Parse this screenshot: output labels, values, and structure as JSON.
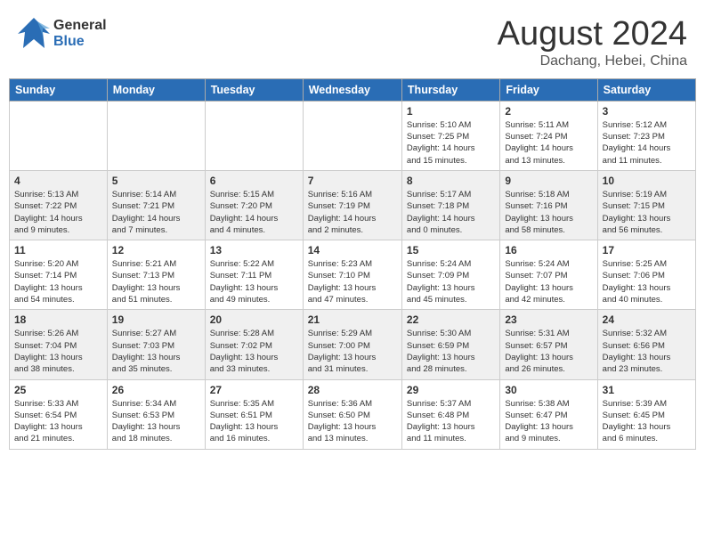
{
  "header": {
    "logo_general": "General",
    "logo_blue": "Blue",
    "month": "August 2024",
    "location": "Dachang, Hebei, China"
  },
  "weekdays": [
    "Sunday",
    "Monday",
    "Tuesday",
    "Wednesday",
    "Thursday",
    "Friday",
    "Saturday"
  ],
  "weeks": [
    [
      {
        "day": "",
        "info": ""
      },
      {
        "day": "",
        "info": ""
      },
      {
        "day": "",
        "info": ""
      },
      {
        "day": "",
        "info": ""
      },
      {
        "day": "1",
        "info": "Sunrise: 5:10 AM\nSunset: 7:25 PM\nDaylight: 14 hours\nand 15 minutes."
      },
      {
        "day": "2",
        "info": "Sunrise: 5:11 AM\nSunset: 7:24 PM\nDaylight: 14 hours\nand 13 minutes."
      },
      {
        "day": "3",
        "info": "Sunrise: 5:12 AM\nSunset: 7:23 PM\nDaylight: 14 hours\nand 11 minutes."
      }
    ],
    [
      {
        "day": "4",
        "info": "Sunrise: 5:13 AM\nSunset: 7:22 PM\nDaylight: 14 hours\nand 9 minutes."
      },
      {
        "day": "5",
        "info": "Sunrise: 5:14 AM\nSunset: 7:21 PM\nDaylight: 14 hours\nand 7 minutes."
      },
      {
        "day": "6",
        "info": "Sunrise: 5:15 AM\nSunset: 7:20 PM\nDaylight: 14 hours\nand 4 minutes."
      },
      {
        "day": "7",
        "info": "Sunrise: 5:16 AM\nSunset: 7:19 PM\nDaylight: 14 hours\nand 2 minutes."
      },
      {
        "day": "8",
        "info": "Sunrise: 5:17 AM\nSunset: 7:18 PM\nDaylight: 14 hours\nand 0 minutes."
      },
      {
        "day": "9",
        "info": "Sunrise: 5:18 AM\nSunset: 7:16 PM\nDaylight: 13 hours\nand 58 minutes."
      },
      {
        "day": "10",
        "info": "Sunrise: 5:19 AM\nSunset: 7:15 PM\nDaylight: 13 hours\nand 56 minutes."
      }
    ],
    [
      {
        "day": "11",
        "info": "Sunrise: 5:20 AM\nSunset: 7:14 PM\nDaylight: 13 hours\nand 54 minutes."
      },
      {
        "day": "12",
        "info": "Sunrise: 5:21 AM\nSunset: 7:13 PM\nDaylight: 13 hours\nand 51 minutes."
      },
      {
        "day": "13",
        "info": "Sunrise: 5:22 AM\nSunset: 7:11 PM\nDaylight: 13 hours\nand 49 minutes."
      },
      {
        "day": "14",
        "info": "Sunrise: 5:23 AM\nSunset: 7:10 PM\nDaylight: 13 hours\nand 47 minutes."
      },
      {
        "day": "15",
        "info": "Sunrise: 5:24 AM\nSunset: 7:09 PM\nDaylight: 13 hours\nand 45 minutes."
      },
      {
        "day": "16",
        "info": "Sunrise: 5:24 AM\nSunset: 7:07 PM\nDaylight: 13 hours\nand 42 minutes."
      },
      {
        "day": "17",
        "info": "Sunrise: 5:25 AM\nSunset: 7:06 PM\nDaylight: 13 hours\nand 40 minutes."
      }
    ],
    [
      {
        "day": "18",
        "info": "Sunrise: 5:26 AM\nSunset: 7:04 PM\nDaylight: 13 hours\nand 38 minutes."
      },
      {
        "day": "19",
        "info": "Sunrise: 5:27 AM\nSunset: 7:03 PM\nDaylight: 13 hours\nand 35 minutes."
      },
      {
        "day": "20",
        "info": "Sunrise: 5:28 AM\nSunset: 7:02 PM\nDaylight: 13 hours\nand 33 minutes."
      },
      {
        "day": "21",
        "info": "Sunrise: 5:29 AM\nSunset: 7:00 PM\nDaylight: 13 hours\nand 31 minutes."
      },
      {
        "day": "22",
        "info": "Sunrise: 5:30 AM\nSunset: 6:59 PM\nDaylight: 13 hours\nand 28 minutes."
      },
      {
        "day": "23",
        "info": "Sunrise: 5:31 AM\nSunset: 6:57 PM\nDaylight: 13 hours\nand 26 minutes."
      },
      {
        "day": "24",
        "info": "Sunrise: 5:32 AM\nSunset: 6:56 PM\nDaylight: 13 hours\nand 23 minutes."
      }
    ],
    [
      {
        "day": "25",
        "info": "Sunrise: 5:33 AM\nSunset: 6:54 PM\nDaylight: 13 hours\nand 21 minutes."
      },
      {
        "day": "26",
        "info": "Sunrise: 5:34 AM\nSunset: 6:53 PM\nDaylight: 13 hours\nand 18 minutes."
      },
      {
        "day": "27",
        "info": "Sunrise: 5:35 AM\nSunset: 6:51 PM\nDaylight: 13 hours\nand 16 minutes."
      },
      {
        "day": "28",
        "info": "Sunrise: 5:36 AM\nSunset: 6:50 PM\nDaylight: 13 hours\nand 13 minutes."
      },
      {
        "day": "29",
        "info": "Sunrise: 5:37 AM\nSunset: 6:48 PM\nDaylight: 13 hours\nand 11 minutes."
      },
      {
        "day": "30",
        "info": "Sunrise: 5:38 AM\nSunset: 6:47 PM\nDaylight: 13 hours\nand 9 minutes."
      },
      {
        "day": "31",
        "info": "Sunrise: 5:39 AM\nSunset: 6:45 PM\nDaylight: 13 hours\nand 6 minutes."
      }
    ]
  ]
}
